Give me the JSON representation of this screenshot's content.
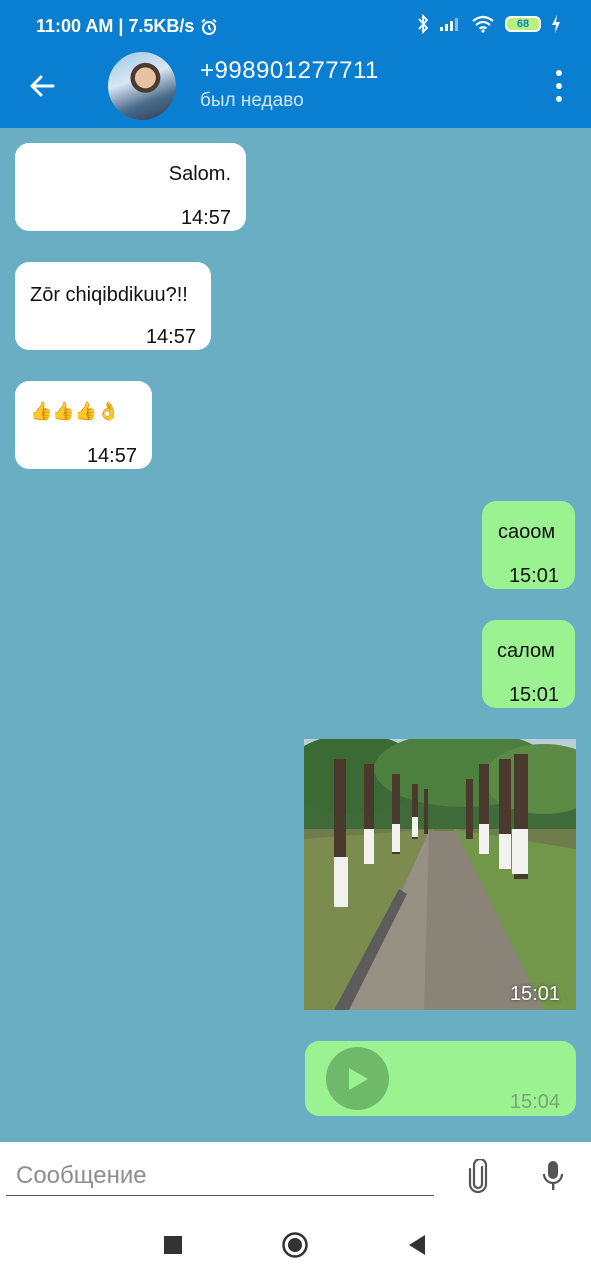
{
  "status_bar": {
    "time_speed": "11:00 AM | 7.5KB/s",
    "battery": "68",
    "icons": [
      "alarm-icon",
      "bluetooth-icon",
      "signal-icon",
      "wifi-icon",
      "battery-icon",
      "charging-icon"
    ]
  },
  "header": {
    "contact_name": "+998901277711",
    "contact_status": "был недаво",
    "icons": [
      "back-arrow-icon",
      "avatar",
      "more-vert-icon"
    ]
  },
  "messages": [
    {
      "direction": "incoming",
      "text": "Salom.",
      "time": "14:57"
    },
    {
      "direction": "incoming",
      "text": "Zōr chiqibdikuu?!!",
      "time": "14:57"
    },
    {
      "direction": "incoming",
      "text": "👍👍👍👌",
      "time": "14:57"
    },
    {
      "direction": "outgoing",
      "text": "саоом",
      "time": "15:01"
    },
    {
      "direction": "outgoing",
      "text": "салом",
      "time": "15:01"
    },
    {
      "direction": "outgoing",
      "type": "photo",
      "time": "15:01"
    },
    {
      "direction": "outgoing",
      "type": "voice",
      "time": "15:04"
    }
  ],
  "composer": {
    "placeholder": "Сообщение",
    "icons": [
      "paperclip-icon",
      "microphone-icon"
    ]
  },
  "nav_bar": {
    "icons": [
      "recents-square-icon",
      "home-circle-icon",
      "back-triangle-icon"
    ]
  },
  "colors": {
    "app_bar": "#0a7fd1",
    "chat_background": "#6aaec4",
    "incoming_bubble": "#ffffff",
    "outgoing_bubble": "#9af291"
  }
}
